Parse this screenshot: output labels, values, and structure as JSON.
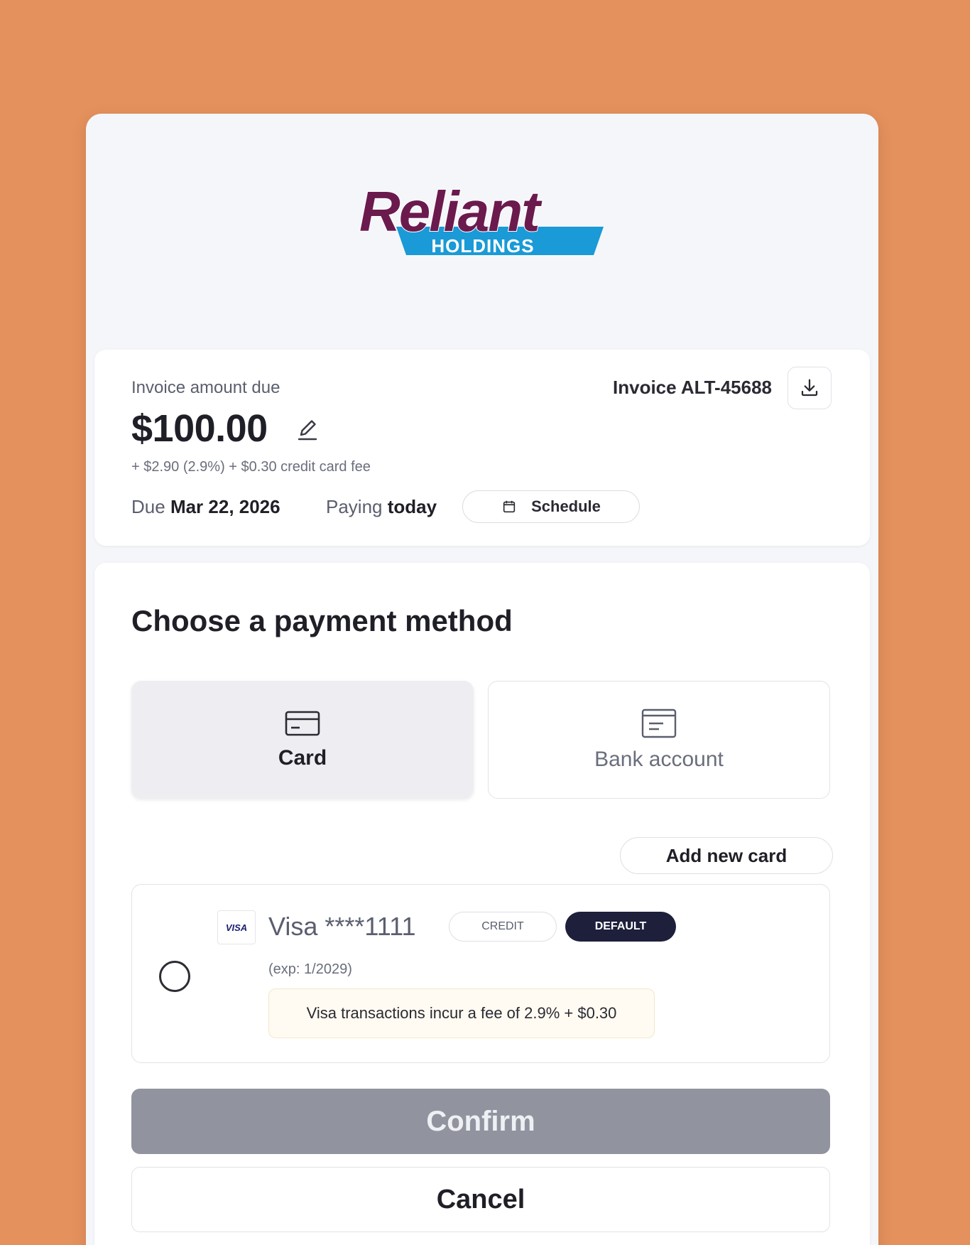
{
  "brand": {
    "name": "Reliant",
    "subname": "HOLDINGS",
    "colors": {
      "primary": "#6b1a4e",
      "accent": "#1a9ad6",
      "page_bg": "#e5915d"
    }
  },
  "invoice": {
    "amount_label": "Invoice amount due",
    "amount": "$100.00",
    "fee_text": "+ $2.90 (2.9%) + $0.30 credit card fee",
    "due_prefix": "Due",
    "due_date": "Mar 22, 2026",
    "paying_prefix": "Paying",
    "paying_when": "today",
    "schedule_label": "Schedule",
    "invoice_number": "Invoice ALT-45688",
    "icons": {
      "edit": "pencil-icon",
      "download": "download-icon",
      "schedule": "calendar-icon"
    }
  },
  "payment": {
    "title": "Choose a payment method",
    "methods": [
      {
        "label": "Card",
        "icon": "credit-card-icon",
        "selected": true
      },
      {
        "label": "Bank account",
        "icon": "bank-icon",
        "selected": false
      }
    ],
    "add_card_label": "Add new card",
    "saved_card": {
      "brand": "VISA",
      "name": "Visa ****1111",
      "type_badge": "CREDIT",
      "default_badge": "DEFAULT",
      "expiry": "(exp: 1/2029)",
      "fee_note": "Visa transactions incur a fee of 2.9% + $0.30",
      "selected": false
    },
    "confirm_label": "Confirm",
    "cancel_label": "Cancel"
  }
}
